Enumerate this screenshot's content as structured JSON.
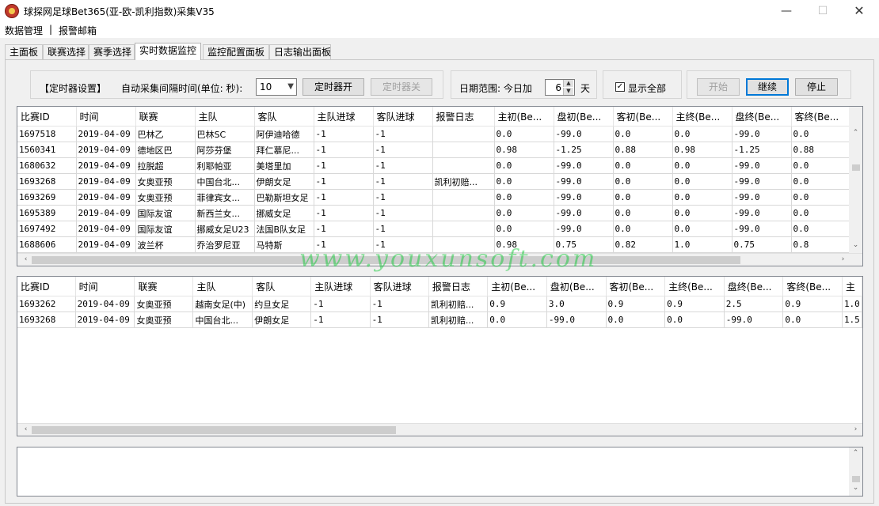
{
  "window": {
    "title": "球探网足球Bet365(亚-欧-凯利指数)采集V35"
  },
  "menu": {
    "items": [
      "数据管理",
      "报警邮箱"
    ],
    "separator": "|"
  },
  "tabs": [
    "主面板",
    "联赛选择",
    "赛季选择",
    "实时数据监控",
    "监控配置面板",
    "日志输出面板"
  ],
  "active_tab": 3,
  "controls": {
    "timer_settings_label": "【定时器设置】",
    "interval_label": "自动采集间隔时间(单位: 秒):",
    "interval_value": "10",
    "timer_on": "定时器开",
    "timer_off": "定时器关",
    "date_range_label": "日期范围: 今日加",
    "date_value": "6",
    "day_unit": "天",
    "show_all": "显示全部",
    "start": "开始",
    "continue": "继续",
    "stop": "停止"
  },
  "columns": [
    "比赛ID",
    "时间",
    "联赛",
    "主队",
    "客队",
    "主队进球",
    "客队进球",
    "报警日志",
    "主初(Be...",
    "盘初(Be...",
    "客初(Be...",
    "主终(Be...",
    "盘终(Be...",
    "客终(Be..."
  ],
  "grid1_rows": [
    [
      "1697518",
      "2019-04-09",
      "巴林乙",
      "巴林SC",
      "阿伊迪哈德",
      "-1",
      "-1",
      "",
      "0.0",
      "-99.0",
      "0.0",
      "0.0",
      "-99.0",
      "0.0"
    ],
    [
      "1560341",
      "2019-04-09",
      "德地区巴",
      "阿莎芬堡",
      "拜仁慕尼...",
      "-1",
      "-1",
      "",
      "0.98",
      "-1.25",
      "0.88",
      "0.98",
      "-1.25",
      "0.88"
    ],
    [
      "1680632",
      "2019-04-09",
      "拉脱超",
      "利耶帕亚",
      "美塔里加",
      "-1",
      "-1",
      "",
      "0.0",
      "-99.0",
      "0.0",
      "0.0",
      "-99.0",
      "0.0"
    ],
    [
      "1693268",
      "2019-04-09",
      "女奥亚预",
      "中国台北...",
      "伊朗女足",
      "-1",
      "-1",
      "凯利初赔...",
      "0.0",
      "-99.0",
      "0.0",
      "0.0",
      "-99.0",
      "0.0"
    ],
    [
      "1693269",
      "2019-04-09",
      "女奥亚预",
      "菲律宾女...",
      "巴勒斯坦女足",
      "-1",
      "-1",
      "",
      "0.0",
      "-99.0",
      "0.0",
      "0.0",
      "-99.0",
      "0.0"
    ],
    [
      "1695389",
      "2019-04-09",
      "国际友谊",
      "新西兰女...",
      "挪威女足",
      "-1",
      "-1",
      "",
      "0.0",
      "-99.0",
      "0.0",
      "0.0",
      "-99.0",
      "0.0"
    ],
    [
      "1697492",
      "2019-04-09",
      "国际友谊",
      "挪威女足U23",
      "法国B队女足",
      "-1",
      "-1",
      "",
      "0.0",
      "-99.0",
      "0.0",
      "0.0",
      "-99.0",
      "0.0"
    ],
    [
      "1688606",
      "2019-04-09",
      "波兰杯",
      "乔治罗尼亚",
      "马特斯",
      "-1",
      "-1",
      "",
      "0.98",
      "0.75",
      "0.82",
      "1.0",
      "0.75",
      "0.8"
    ]
  ],
  "grid2_columns": [
    "比赛ID",
    "时间",
    "联赛",
    "主队",
    "客队",
    "主队进球",
    "客队进球",
    "报警日志",
    "主初(Be...",
    "盘初(Be...",
    "客初(Be...",
    "主终(Be...",
    "盘终(Be...",
    "客终(Be...",
    "主"
  ],
  "grid2_rows": [
    [
      "1693262",
      "2019-04-09",
      "女奥亚预",
      "越南女足(中)",
      "约旦女足",
      "-1",
      "-1",
      "凯利初赔...",
      "0.9",
      "3.0",
      "0.9",
      "0.9",
      "2.5",
      "0.9",
      "1.0"
    ],
    [
      "1693268",
      "2019-04-09",
      "女奥亚预",
      "中国台北...",
      "伊朗女足",
      "-1",
      "-1",
      "凯利初赔...",
      "0.0",
      "-99.0",
      "0.0",
      "0.0",
      "-99.0",
      "0.0",
      "1.5"
    ]
  ],
  "watermark": "www.youxunsoft.com"
}
